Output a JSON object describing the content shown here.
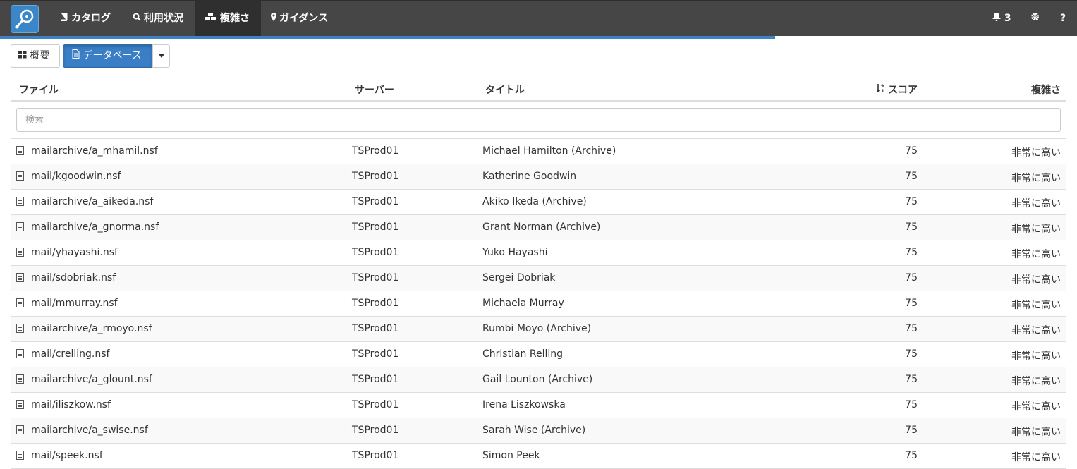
{
  "nav": {
    "catalog": "カタログ",
    "usage": "利用状況",
    "complexity": "複雑さ",
    "guidance": "ガイダンス",
    "notifications_count": "3",
    "help": "?"
  },
  "toolbar": {
    "overview": "概要",
    "database": "データベース"
  },
  "table": {
    "headers": {
      "file": "ファイル",
      "server": "サーバー",
      "title": "タイトル",
      "score": "スコア",
      "complexity": "複雑さ"
    },
    "search_placeholder": "検索",
    "rows": [
      {
        "file": "mailarchive/a_mhamil.nsf",
        "server": "TSProd01",
        "title": "Michael Hamilton (Archive)",
        "score": "75",
        "complexity": "非常に高い"
      },
      {
        "file": "mail/kgoodwin.nsf",
        "server": "TSProd01",
        "title": "Katherine Goodwin",
        "score": "75",
        "complexity": "非常に高い"
      },
      {
        "file": "mailarchive/a_aikeda.nsf",
        "server": "TSProd01",
        "title": "Akiko Ikeda (Archive)",
        "score": "75",
        "complexity": "非常に高い"
      },
      {
        "file": "mailarchive/a_gnorma.nsf",
        "server": "TSProd01",
        "title": "Grant Norman (Archive)",
        "score": "75",
        "complexity": "非常に高い"
      },
      {
        "file": "mail/yhayashi.nsf",
        "server": "TSProd01",
        "title": "Yuko Hayashi",
        "score": "75",
        "complexity": "非常に高い"
      },
      {
        "file": "mail/sdobriak.nsf",
        "server": "TSProd01",
        "title": "Sergei Dobriak",
        "score": "75",
        "complexity": "非常に高い"
      },
      {
        "file": "mail/mmurray.nsf",
        "server": "TSProd01",
        "title": "Michaela Murray",
        "score": "75",
        "complexity": "非常に高い"
      },
      {
        "file": "mailarchive/a_rmoyo.nsf",
        "server": "TSProd01",
        "title": "Rumbi Moyo (Archive)",
        "score": "75",
        "complexity": "非常に高い"
      },
      {
        "file": "mail/crelling.nsf",
        "server": "TSProd01",
        "title": "Christian Relling",
        "score": "75",
        "complexity": "非常に高い"
      },
      {
        "file": "mailarchive/a_glount.nsf",
        "server": "TSProd01",
        "title": "Gail Lounton (Archive)",
        "score": "75",
        "complexity": "非常に高い"
      },
      {
        "file": "mail/iliszkow.nsf",
        "server": "TSProd01",
        "title": "Irena Liszkowska",
        "score": "75",
        "complexity": "非常に高い"
      },
      {
        "file": "mailarchive/a_swise.nsf",
        "server": "TSProd01",
        "title": "Sarah Wise (Archive)",
        "score": "75",
        "complexity": "非常に高い"
      },
      {
        "file": "mail/speek.nsf",
        "server": "TSProd01",
        "title": "Simon Peek",
        "score": "75",
        "complexity": "非常に高い"
      }
    ]
  },
  "colors": {
    "navbar": "#464646",
    "accent": "#3a7ec5"
  }
}
